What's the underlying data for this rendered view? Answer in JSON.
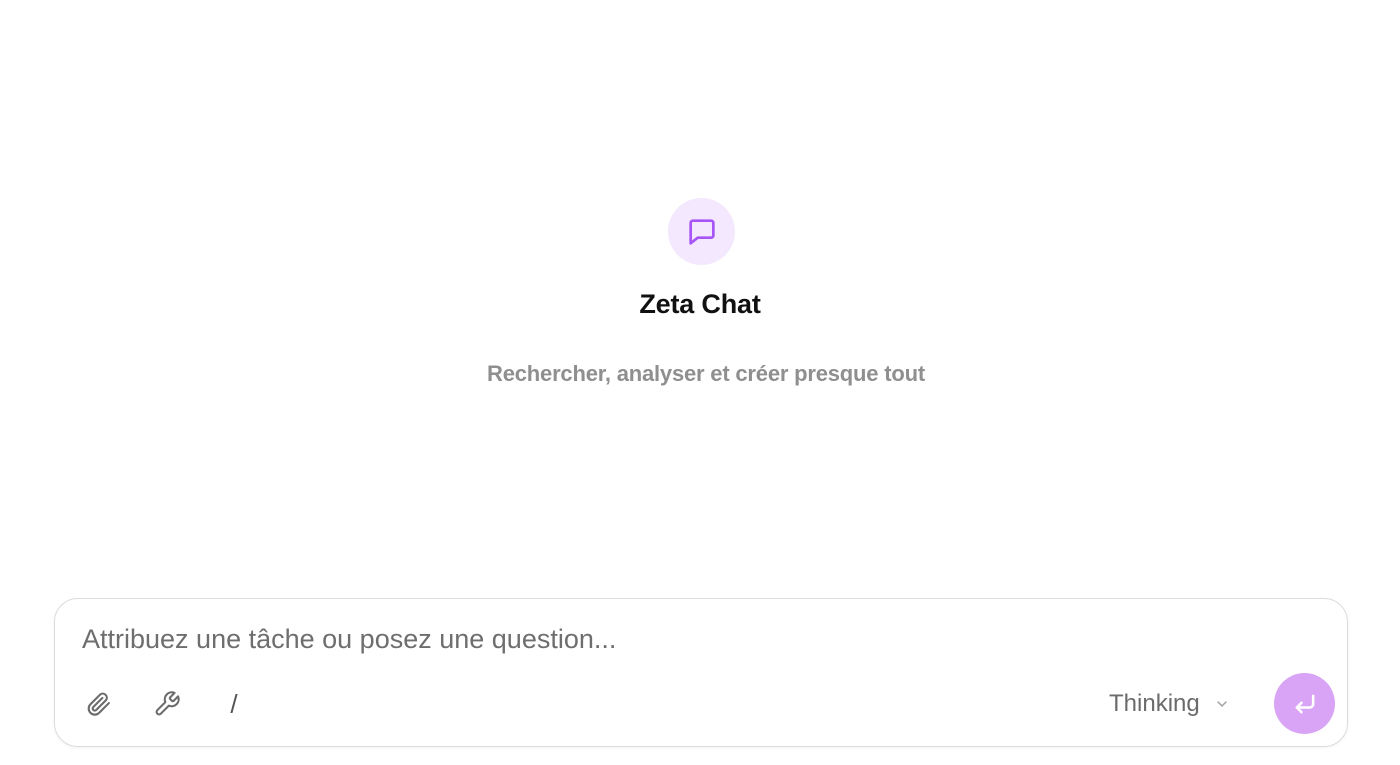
{
  "app": {
    "title": "Zeta Chat",
    "subtitle": "Rechercher, analyser et créer presque tout",
    "icon": "chat-bubble-icon",
    "accent_color": "#a855f7"
  },
  "composer": {
    "placeholder": "Attribuez une tâche ou posez une question...",
    "value": "",
    "tools": [
      {
        "name": "attach",
        "icon": "paperclip-icon"
      },
      {
        "name": "tools",
        "icon": "wrench-icon"
      },
      {
        "name": "commands",
        "label": "/"
      }
    ],
    "mode": {
      "selected": "Thinking",
      "icon": "chevron-down-icon"
    },
    "send": {
      "icon": "enter-icon",
      "color": "#d9a4f5"
    }
  }
}
